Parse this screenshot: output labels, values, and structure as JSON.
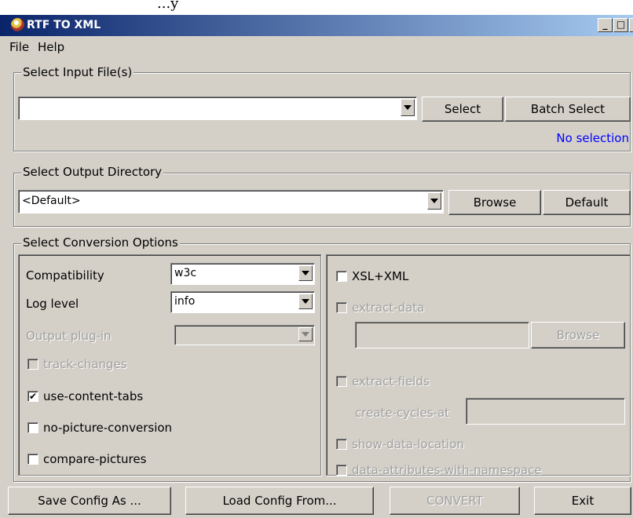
{
  "above_window_text": "...y",
  "window": {
    "title": "RTF TO XML",
    "minimize": "_",
    "maximize": "□",
    "close": "×"
  },
  "menu": {
    "file": "File",
    "help": "Help"
  },
  "input_group": {
    "legend": "Select Input File(s)",
    "file_value": "",
    "select_label": "Select",
    "batch_select_label": "Batch Select",
    "status": "No selection"
  },
  "output_group": {
    "legend": "Select Output Directory",
    "dir_value": "<Default>",
    "browse_label": "Browse",
    "default_label": "Default"
  },
  "options_group": {
    "legend": "Select Conversion Options",
    "compatibility": {
      "label": "Compatibility",
      "value": "w3c"
    },
    "log_level": {
      "label": "Log level",
      "value": "info"
    },
    "output_plugin": {
      "label": "Output plug-in",
      "value": ""
    },
    "track_changes": {
      "label": "track-changes",
      "checked": false,
      "enabled": false
    },
    "use_content_tabs": {
      "label": "use-content-tabs",
      "checked": true,
      "check_mark": "✔"
    },
    "no_picture_conversion": {
      "label": "no-picture-conversion",
      "checked": false
    },
    "compare_pictures": {
      "label": "compare-pictures",
      "checked": false
    },
    "xsl_xml": {
      "label": "XSL+XML",
      "checked": false
    },
    "extract_data": {
      "label": "extract-data",
      "checked": false,
      "enabled": false
    },
    "extract_data_browse": "Browse",
    "extract_fields": {
      "label": "extract-fields",
      "checked": false,
      "enabled": false
    },
    "create_cycles_at": {
      "label": "create-cycles-at",
      "value": ""
    },
    "show_data_location": {
      "label": "show-data-location",
      "checked": false,
      "enabled": false
    },
    "data_attributes_with_namespace": {
      "label": "data-attributes-with-namespace",
      "checked": false,
      "enabled": false
    }
  },
  "footer": {
    "save_config": "Save Config As ...",
    "load_config": "Load Config From...",
    "convert": "CONVERT",
    "exit": "Exit"
  }
}
